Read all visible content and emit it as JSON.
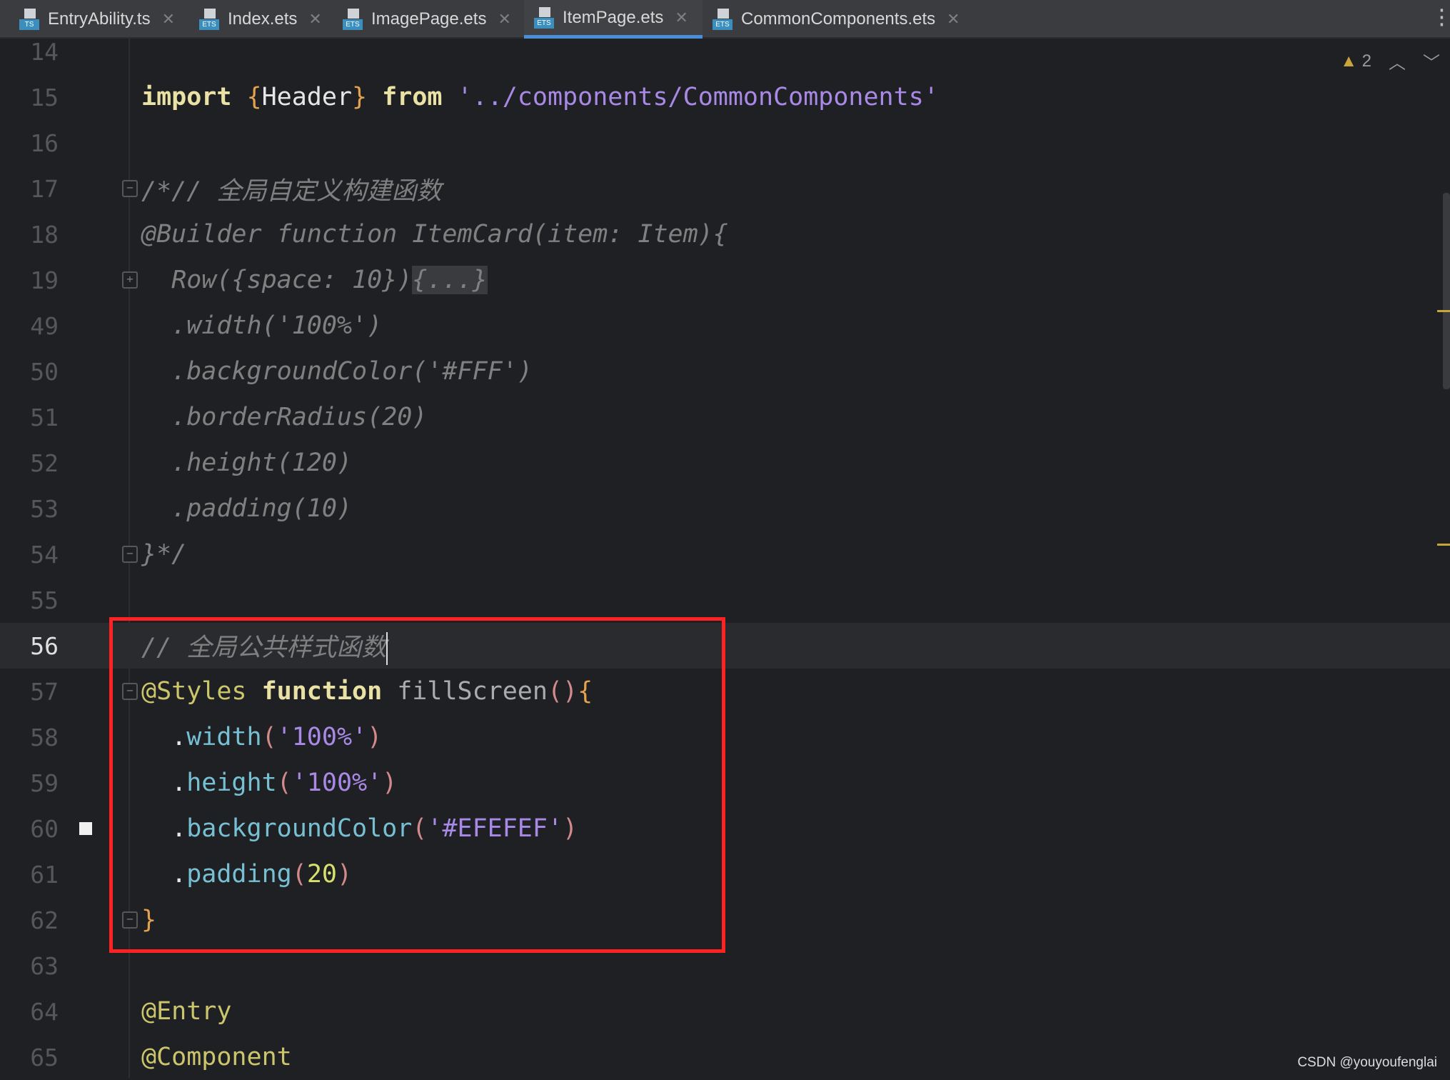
{
  "tabs": [
    {
      "label": "EntryAbility.ts",
      "type": "TS",
      "active": false
    },
    {
      "label": "Index.ets",
      "type": "ETS",
      "active": false
    },
    {
      "label": "ImagePage.ets",
      "type": "ETS",
      "active": false
    },
    {
      "label": "ItemPage.ets",
      "type": "ETS",
      "active": true
    },
    {
      "label": "CommonComponents.ets",
      "type": "ETS",
      "active": false
    }
  ],
  "inspection": {
    "warnings": "2",
    "icon": "warning-icon"
  },
  "watermark": "CSDN @youyoufenglai",
  "current_line": "56",
  "colors": {
    "highlight_box": "#ff2222",
    "active_tab": "#4a8ed8"
  },
  "lines": [
    {
      "n": "14",
      "tokens": []
    },
    {
      "n": "15",
      "tokens": [
        [
          "import ",
          "kw"
        ],
        [
          "{",
          "br"
        ],
        [
          "Header",
          "id"
        ],
        [
          "}",
          "br"
        ],
        [
          " from ",
          "kw"
        ],
        [
          "'../components/CommonComponents'",
          "str"
        ]
      ]
    },
    {
      "n": "16",
      "tokens": []
    },
    {
      "n": "17",
      "fold": "-",
      "tokens": [
        [
          "/*// 全局自定义构建函数",
          "cm"
        ]
      ]
    },
    {
      "n": "18",
      "tokens": [
        [
          "@Builder function ItemCard(item: Item){",
          "cm"
        ]
      ]
    },
    {
      "n": "19",
      "fold": "+",
      "tokens": [
        [
          "  Row({space: 10})",
          "cm"
        ],
        [
          "{...}",
          "cm foldbox"
        ]
      ]
    },
    {
      "n": "49",
      "tokens": [
        [
          "  .width('100%')",
          "cm"
        ]
      ]
    },
    {
      "n": "50",
      "tokens": [
        [
          "  .backgroundColor('#FFF')",
          "cm"
        ]
      ]
    },
    {
      "n": "51",
      "tokens": [
        [
          "  .borderRadius(20)",
          "cm"
        ]
      ]
    },
    {
      "n": "52",
      "tokens": [
        [
          "  .height(120)",
          "cm"
        ]
      ]
    },
    {
      "n": "53",
      "tokens": [
        [
          "  .padding(10)",
          "cm"
        ]
      ]
    },
    {
      "n": "54",
      "fold": "-",
      "tokens": [
        [
          "}*/",
          "cm"
        ]
      ]
    },
    {
      "n": "55",
      "tokens": []
    },
    {
      "n": "56",
      "tokens": [
        [
          "// 全局公共样式函数",
          "cm"
        ]
      ]
    },
    {
      "n": "57",
      "fold": "-",
      "tokens": [
        [
          "@Styles ",
          "an"
        ],
        [
          "function ",
          "kw"
        ],
        [
          "fillScreen",
          "fn"
        ],
        [
          "()",
          "pa"
        ],
        [
          "{",
          "br"
        ]
      ]
    },
    {
      "n": "58",
      "tokens": [
        [
          "  .",
          "id"
        ],
        [
          "width",
          "me"
        ],
        [
          "(",
          "pa"
        ],
        [
          "'100%'",
          "str"
        ],
        [
          ")",
          "pa"
        ]
      ]
    },
    {
      "n": "59",
      "tokens": [
        [
          "  .",
          "id"
        ],
        [
          "height",
          "me"
        ],
        [
          "(",
          "pa"
        ],
        [
          "'100%'",
          "str"
        ],
        [
          ")",
          "pa"
        ]
      ]
    },
    {
      "n": "60",
      "marker": true,
      "tokens": [
        [
          "  .",
          "id"
        ],
        [
          "backgroundColor",
          "me"
        ],
        [
          "(",
          "pa"
        ],
        [
          "'#EFEFEF'",
          "str"
        ],
        [
          ")",
          "pa"
        ]
      ]
    },
    {
      "n": "61",
      "tokens": [
        [
          "  .",
          "id"
        ],
        [
          "padding",
          "me"
        ],
        [
          "(",
          "pa"
        ],
        [
          "20",
          "nu"
        ],
        [
          ")",
          "pa"
        ]
      ]
    },
    {
      "n": "62",
      "fold": "-",
      "tokens": [
        [
          "}",
          "br"
        ]
      ]
    },
    {
      "n": "63",
      "tokens": []
    },
    {
      "n": "64",
      "tokens": [
        [
          "@Entry",
          "an"
        ]
      ]
    },
    {
      "n": "65",
      "tokens": [
        [
          "@Component",
          "an"
        ]
      ]
    }
  ]
}
